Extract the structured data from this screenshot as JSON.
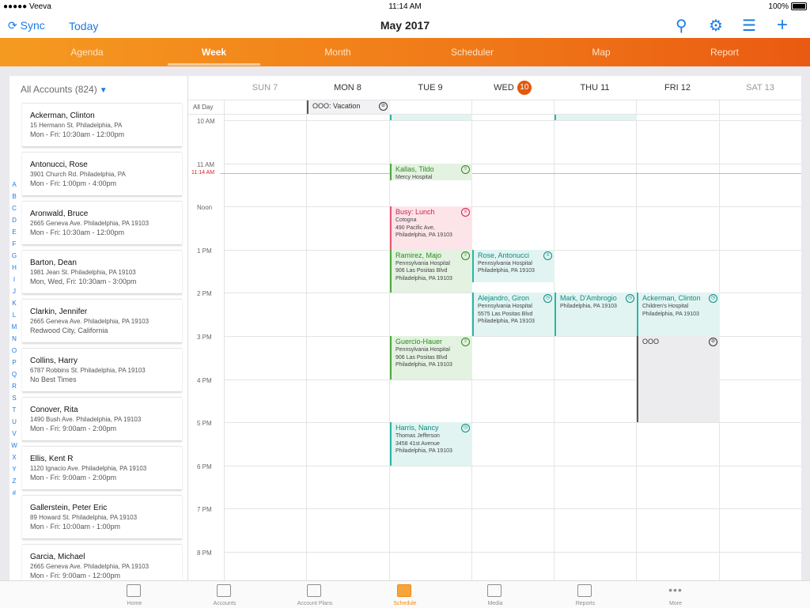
{
  "status_bar": {
    "carrier": "●●●●● Veeva",
    "wifi": "≋",
    "time": "11:14 AM",
    "battery": "100%"
  },
  "nav": {
    "sync_label": "Sync",
    "today_label": "Today",
    "title": "May 2017"
  },
  "tabs": [
    "Agenda",
    "Week",
    "Month",
    "Scheduler",
    "Map",
    "Report"
  ],
  "active_tab": "Week",
  "accounts": {
    "filter_label": "All Accounts (824)",
    "alphabet": [
      "A",
      "B",
      "C",
      "D",
      "E",
      "F",
      "G",
      "H",
      "I",
      "J",
      "K",
      "L",
      "M",
      "N",
      "O",
      "P",
      "Q",
      "R",
      "S",
      "T",
      "U",
      "V",
      "W",
      "X",
      "Y",
      "Z",
      "#"
    ],
    "items": [
      {
        "name": "Ackerman, Clinton",
        "address": "15 Hermann St. Philadelphia, PA",
        "hours": "Mon - Fri: 10:30am - 12:00pm"
      },
      {
        "name": "Antonucci, Rose",
        "address": "3901 Church Rd. Philadelphia, PA",
        "hours": "Mon - Fri: 1:00pm - 4:00pm"
      },
      {
        "name": "Aronwald, Bruce",
        "address": "2665 Geneva Ave. Philadelphia, PA 19103",
        "hours": "Mon - Fri: 10:30am - 12:00pm"
      },
      {
        "name": "Barton, Dean",
        "address": "1981 Jean St. Philadelphia, PA 19103",
        "hours": "Mon, Wed, Fri: 10:30am - 3:00pm"
      },
      {
        "name": "Clarkin, Jennifer",
        "address": "2665 Geneva Ave. Philadelphia, PA 19103",
        "hours": "Redwood City, California"
      },
      {
        "name": "Collins, Harry",
        "address": "6787 Robbins St. Philadelphia, PA 19103",
        "hours": "No Best Times"
      },
      {
        "name": "Conover, Rita",
        "address": "1490 Bush Ave. Philadelphia, PA 19103",
        "hours": "Mon - Fri: 9:00am - 2:00pm"
      },
      {
        "name": "Ellis, Kent R",
        "address": "1120 Ignacio Ave. Philadelphia, PA 19103",
        "hours": "Mon - Fri: 9:00am - 2:00pm"
      },
      {
        "name": "Gallerstein, Peter Eric",
        "address": "89 Howard St. Philadelphia, PA 19103",
        "hours": "Mon - Fri: 10:00am - 1:00pm"
      },
      {
        "name": "Garcia, Michael",
        "address": "2665 Geneva Ave. Philadelphia, PA 19103",
        "hours": "Mon - Fri: 9:00am - 12:00pm"
      }
    ]
  },
  "calendar": {
    "days": [
      {
        "label": "SUN 7",
        "dim": true
      },
      {
        "label": "MON 8",
        "dim": false
      },
      {
        "label": "TUE 9",
        "dim": false
      },
      {
        "label": "WED",
        "badge": "10",
        "dim": false
      },
      {
        "label": "THU 11",
        "dim": false
      },
      {
        "label": "FRI 12",
        "dim": false
      },
      {
        "label": "SAT 13",
        "dim": true
      }
    ],
    "all_day_label": "All Day",
    "hours": [
      "10 AM",
      "11 AM",
      "Noon",
      "1 PM",
      "2 PM",
      "3 PM",
      "4 PM",
      "5 PM",
      "6 PM",
      "7 PM",
      "8 PM"
    ],
    "now_label": "11:14 AM",
    "all_day_events": [
      {
        "day": 1,
        "title": "OOO: Vacation",
        "type": "gray",
        "icon": "blocked-icon"
      }
    ],
    "events": [
      {
        "day": 2,
        "start": 9.75,
        "end": 10.0,
        "type": "teal",
        "title": "",
        "lines": []
      },
      {
        "day": 4,
        "start": 9.75,
        "end": 10.0,
        "type": "teal",
        "title": "",
        "lines": []
      },
      {
        "day": 2,
        "start": 11.0,
        "end": 11.4,
        "type": "green",
        "title": "Kallas, Tildo",
        "lines": [
          "Mercy Hospital"
        ],
        "icon": "person-icon"
      },
      {
        "day": 2,
        "start": 12.0,
        "end": 13.0,
        "type": "red",
        "title": "Busy: Lunch",
        "lines": [
          "Cotogna",
          "490 Pacific Ave,",
          "Philadelphia, PA 19103"
        ],
        "icon": "meal-icon"
      },
      {
        "day": 2,
        "start": 13.0,
        "end": 14.0,
        "type": "green",
        "title": "Ramirez, Majo",
        "lines": [
          "Pennsylvania Hospital",
          "906 Las Positas Blvd",
          "Philadelphia, PA 19103"
        ],
        "icon": "person-icon"
      },
      {
        "day": 3,
        "start": 13.0,
        "end": 13.75,
        "type": "teal",
        "title": "Rose, Antonucci",
        "lines": [
          "Pennsylvania Hospital",
          "Philadelphia, PA 19103"
        ],
        "icon": "meal-icon"
      },
      {
        "day": 3,
        "start": 14.0,
        "end": 15.0,
        "type": "teal",
        "title": "Alejandro, Giron",
        "lines": [
          "Pennsylvania Hospital",
          "5575 Las Positas Blvd",
          "Philadelphia, PA 19103"
        ],
        "icon": "clock-icon"
      },
      {
        "day": 4,
        "start": 14.0,
        "end": 15.0,
        "type": "teal",
        "title": "Mark, D'Ambrogio",
        "lines": [
          "Philadelphia, PA 19103"
        ],
        "icon": "clock-icon"
      },
      {
        "day": 5,
        "start": 14.0,
        "end": 15.0,
        "type": "teal",
        "title": "Ackerman, Clinton",
        "lines": [
          "Children's Hospital",
          "Philadelphia, PA 19103"
        ],
        "icon": "clock-icon"
      },
      {
        "day": 2,
        "start": 15.0,
        "end": 16.0,
        "type": "green",
        "title": "Guercio-Hauer",
        "lines": [
          "Pennsylvania Hospital",
          "906 Las Positas Blvd",
          "Philadelphia, PA 19103"
        ],
        "icon": "person-icon"
      },
      {
        "day": 5,
        "start": 15.0,
        "end": 17.0,
        "type": "gray",
        "title": "OOO",
        "lines": [],
        "icon": "blocked-icon"
      },
      {
        "day": 2,
        "start": 17.0,
        "end": 18.0,
        "type": "teal",
        "title": "Harris, Nancy",
        "lines": [
          "Thomas Jefferson",
          "3458 41st Avenue",
          "Philadelphia, PA 19103"
        ],
        "icon": "clock-icon"
      }
    ]
  },
  "bottom_tabs": [
    {
      "label": "Home",
      "icon": "home-icon"
    },
    {
      "label": "Accounts",
      "icon": "accounts-icon"
    },
    {
      "label": "Account Plans",
      "icon": "account-plans-icon"
    },
    {
      "label": "Schedule",
      "icon": "calendar-icon",
      "active": true
    },
    {
      "label": "Media",
      "icon": "media-icon"
    },
    {
      "label": "Reports",
      "icon": "reports-icon"
    },
    {
      "label": "More",
      "icon": "more-icon"
    }
  ],
  "colors": {
    "accent": "#1a7be5",
    "orange": "#f07818",
    "today": "#e3580c"
  }
}
